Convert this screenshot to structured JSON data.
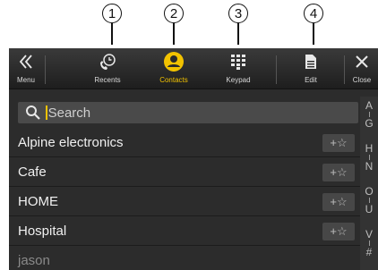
{
  "callouts": [
    "1",
    "2",
    "3",
    "4"
  ],
  "topbar": {
    "menu_label": "Menu",
    "recents_label": "Recents",
    "contacts_label": "Contacts",
    "keypad_label": "Keypad",
    "edit_label": "Edit",
    "close_label": "Close"
  },
  "search": {
    "placeholder": "Search"
  },
  "contacts": [
    {
      "name": "Alpine electronics",
      "fav": "+☆"
    },
    {
      "name": "Cafe",
      "fav": "+☆"
    },
    {
      "name": "HOME",
      "fav": "+☆"
    },
    {
      "name": "Hospital",
      "fav": "+☆"
    },
    {
      "name": "jason",
      "fav": ""
    }
  ],
  "index": [
    {
      "top": "A",
      "bottom": "G"
    },
    {
      "top": "H",
      "bottom": "N"
    },
    {
      "top": "O",
      "bottom": "U"
    },
    {
      "top": "V",
      "bottom": "#"
    }
  ],
  "colors": {
    "accent": "#f2c200",
    "background": "#2c2c2c",
    "text": "#f0f0f0"
  }
}
